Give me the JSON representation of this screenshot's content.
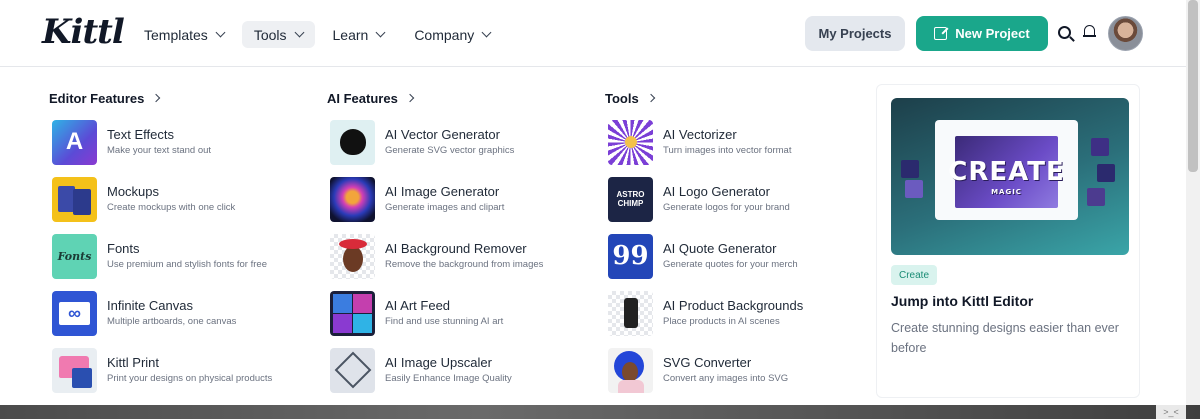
{
  "header": {
    "logo": "Kittl",
    "nav": [
      {
        "label": "Templates"
      },
      {
        "label": "Tools"
      },
      {
        "label": "Learn"
      },
      {
        "label": "Company"
      }
    ],
    "my_projects": "My Projects",
    "new_project": "New Project"
  },
  "columns": [
    {
      "title": "Editor Features",
      "items": [
        {
          "title": "Text Effects",
          "subtitle": "Make your text stand out",
          "thumb": "A"
        },
        {
          "title": "Mockups",
          "subtitle": "Create mockups with one click",
          "thumb": ""
        },
        {
          "title": "Fonts",
          "subtitle": "Use premium and stylish fonts for free",
          "thumb": "Fonts"
        },
        {
          "title": "Infinite Canvas",
          "subtitle": "Multiple artboards, one canvas",
          "thumb": "∞"
        },
        {
          "title": "Kittl Print",
          "subtitle": "Print your designs on physical products",
          "thumb": ""
        }
      ]
    },
    {
      "title": "AI Features",
      "items": [
        {
          "title": "AI Vector Generator",
          "subtitle": "Generate SVG vector graphics",
          "thumb": ""
        },
        {
          "title": "AI Image Generator",
          "subtitle": "Generate images and clipart",
          "thumb": ""
        },
        {
          "title": "AI Background Remover",
          "subtitle": "Remove the background from images",
          "thumb": ""
        },
        {
          "title": "AI Art Feed",
          "subtitle": "Find and use stunning AI art",
          "thumb": ""
        },
        {
          "title": "AI Image Upscaler",
          "subtitle": "Easily Enhance Image Quality",
          "thumb": ""
        }
      ]
    },
    {
      "title": "Tools",
      "items": [
        {
          "title": "AI Vectorizer",
          "subtitle": "Turn images into vector format",
          "thumb": ""
        },
        {
          "title": "AI Logo Generator",
          "subtitle": "Generate logos for your brand",
          "thumb": "ASTRO CHIMP"
        },
        {
          "title": "AI Quote Generator",
          "subtitle": "Generate quotes for your merch",
          "thumb": "99"
        },
        {
          "title": "AI Product Backgrounds",
          "subtitle": "Place products in AI scenes",
          "thumb": ""
        },
        {
          "title": "SVG Converter",
          "subtitle": "Convert any images into SVG",
          "thumb": ""
        }
      ]
    }
  ],
  "promo": {
    "art_text": "CREATE",
    "art_sub": "MAGIC",
    "badge": "Create",
    "title": "Jump into Kittl Editor",
    "description": "Create stunning designs easier than ever before"
  },
  "colors": {
    "accent": "#1aa78b",
    "secondary_button": "#e4e8ee"
  }
}
